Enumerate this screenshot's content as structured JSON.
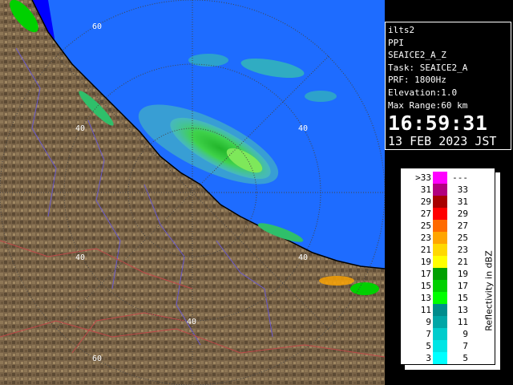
{
  "info": {
    "station": "ilts2",
    "product": "PPI",
    "scan": "SEAICE2_A_Z",
    "task": "Task: SEAICE2_A",
    "prf": "PRF: 1800Hz",
    "elevation": "Elevation:1.0",
    "max_range": "Max Range:60 km",
    "time": "16:59:31",
    "date": "13 FEB 2023 JST"
  },
  "ring_labels": {
    "top_60": "60",
    "upper_40_left": "40",
    "upper_40_right": "40",
    "lower_40_left": "40",
    "lower_40_right": "40",
    "bottom_40": "40",
    "bottom_60": "60"
  },
  "legend": {
    "title": "Reflectivity in dBZ",
    "rows": [
      {
        "left": ">33",
        "right": "---",
        "color": "#ff00ff"
      },
      {
        "left": "31",
        "right": "33",
        "color": "#b2007f"
      },
      {
        "left": "29",
        "right": "31",
        "color": "#a80000"
      },
      {
        "left": "27",
        "right": "29",
        "color": "#ff0000"
      },
      {
        "left": "25",
        "right": "27",
        "color": "#ff6a00"
      },
      {
        "left": "23",
        "right": "25",
        "color": "#ffa500"
      },
      {
        "left": "21",
        "right": "23",
        "color": "#ffd800"
      },
      {
        "left": "19",
        "right": "21",
        "color": "#ffff00"
      },
      {
        "left": "17",
        "right": "19",
        "color": "#00a000"
      },
      {
        "left": "15",
        "right": "17",
        "color": "#00d000"
      },
      {
        "left": "13",
        "right": "15",
        "color": "#00ff00"
      },
      {
        "left": "11",
        "right": "13",
        "color": "#008c8c"
      },
      {
        "left": "9",
        "right": "11",
        "color": "#00a6a6"
      },
      {
        "left": "7",
        "right": "9",
        "color": "#00cccc"
      },
      {
        "left": "5",
        "right": "7",
        "color": "#00e5e5"
      },
      {
        "left": "3",
        "right": "5",
        "color": "#00ffff"
      }
    ]
  }
}
